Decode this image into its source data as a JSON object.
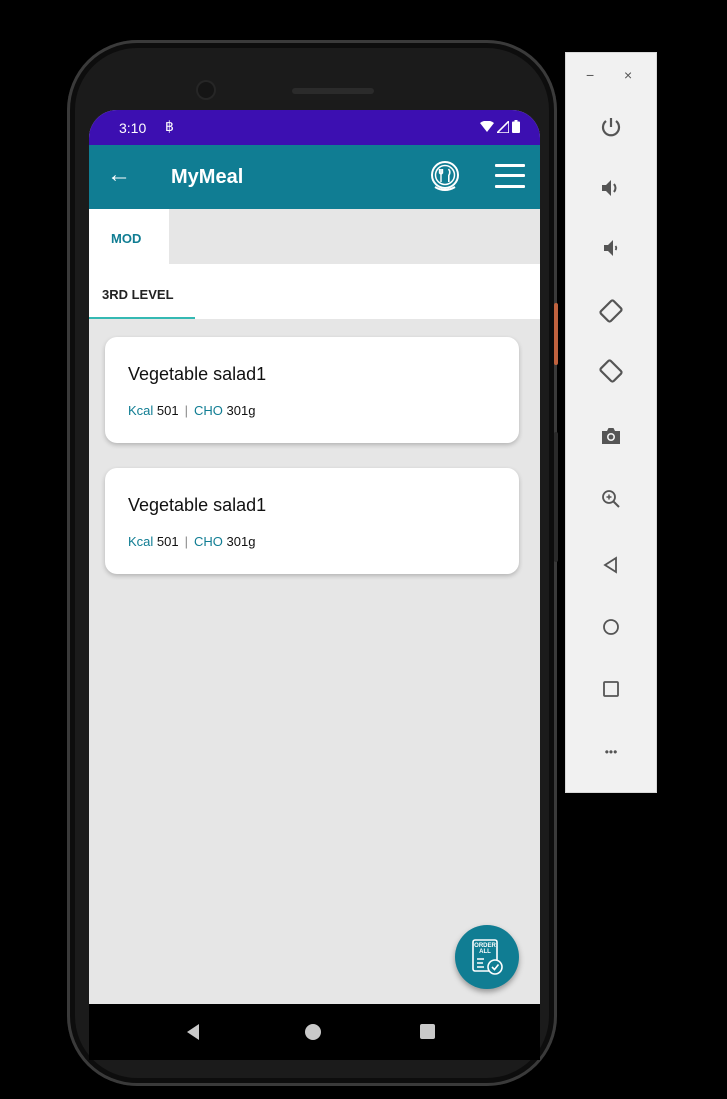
{
  "status_bar": {
    "time": "3:10",
    "sim_glyph": "฿"
  },
  "app_bar": {
    "back_glyph": "←",
    "title": "MyMeal"
  },
  "tabs": {
    "primary": [
      {
        "label": "MOD",
        "selected": true
      }
    ],
    "secondary": [
      {
        "label": "3RD LEVEL",
        "selected": true
      }
    ]
  },
  "meals": [
    {
      "name": "Vegetable salad1",
      "kcal_label": "Kcal",
      "kcal": "501",
      "separator": "|",
      "cho_label": "CHO",
      "cho": "301g"
    },
    {
      "name": "Vegetable salad1",
      "kcal_label": "Kcal",
      "kcal": "501",
      "separator": "|",
      "cho_label": "CHO",
      "cho": "301g"
    }
  ],
  "fab": {
    "line1": "ORDER",
    "line2": "ALL"
  },
  "emulator_toolbar": {
    "window_controls": {
      "minimize": "−",
      "close": "×"
    },
    "more_glyph": "•••"
  },
  "colors": {
    "status_bar": "#3c0fb1",
    "app_bar": "#107d93",
    "accent": "#107d93",
    "tab_indicator": "#34b9b3",
    "screen_bg": "#e6e6e6"
  }
}
